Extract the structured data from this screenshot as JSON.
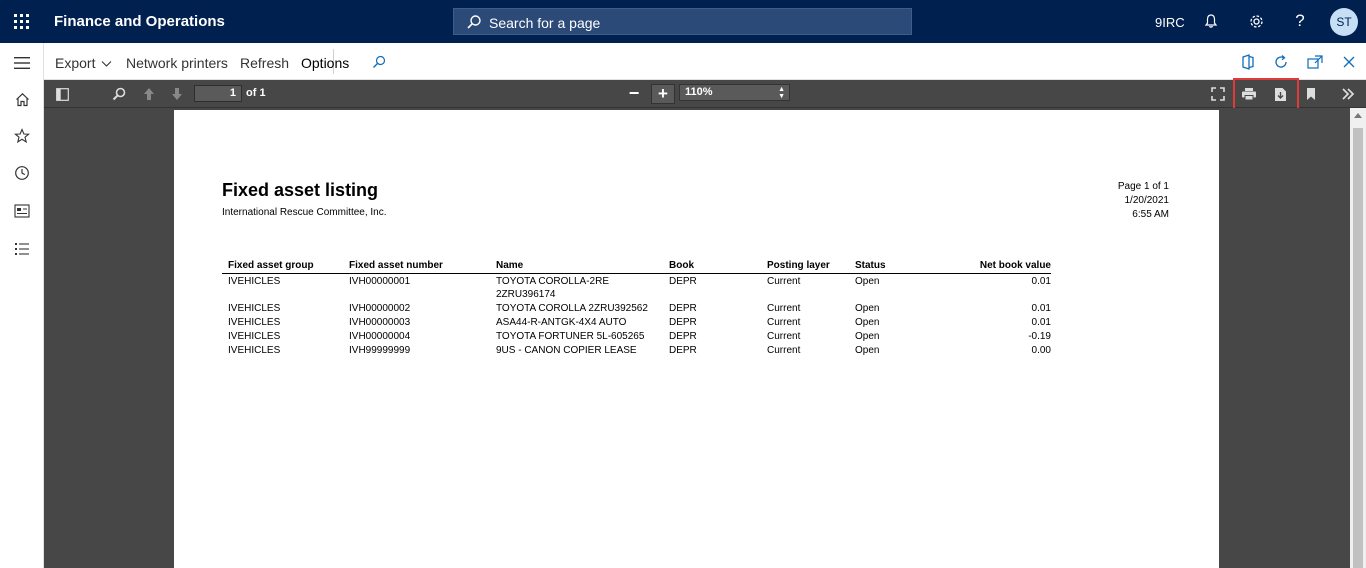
{
  "header": {
    "app_title": "Finance and Operations",
    "search_placeholder": "Search for a page",
    "company": "9IRC",
    "user_initials": "ST"
  },
  "action_pane": {
    "export_label": "Export",
    "network_printers_label": "Network printers",
    "refresh_label": "Refresh",
    "options_label": "Options"
  },
  "viewer": {
    "current_page": "1",
    "page_of": "of 1",
    "zoom": "110%"
  },
  "report": {
    "title": "Fixed asset listing",
    "company": "International Rescue Committee, Inc.",
    "page_info": "Page 1 of 1",
    "date": "1/20/2021",
    "time": "6:55 AM",
    "columns": [
      "Fixed asset group",
      "Fixed asset number",
      "Name",
      "Book",
      "Posting layer",
      "Status",
      "Net book value"
    ],
    "rows": [
      {
        "group": "IVEHICLES",
        "number": "IVH00000001",
        "name_line1": "TOYOTA COROLLA-2RE",
        "name_line2": "2ZRU396174",
        "book": "DEPR",
        "layer": "Current",
        "status": "Open",
        "value": "0.01"
      },
      {
        "group": "IVEHICLES",
        "number": "IVH00000002",
        "name_line1": "TOYOTA COROLLA 2ZRU392562",
        "name_line2": "",
        "book": "DEPR",
        "layer": "Current",
        "status": "Open",
        "value": "0.01"
      },
      {
        "group": "IVEHICLES",
        "number": "IVH00000003",
        "name_line1": "ASA44-R-ANTGK-4X4 AUTO",
        "name_line2": "",
        "book": "DEPR",
        "layer": "Current",
        "status": "Open",
        "value": "0.01"
      },
      {
        "group": "IVEHICLES",
        "number": "IVH00000004",
        "name_line1": "TOYOTA FORTUNER 5L-605265",
        "name_line2": "",
        "book": "DEPR",
        "layer": "Current",
        "status": "Open",
        "value": "-0.19"
      },
      {
        "group": "IVEHICLES",
        "number": "IVH99999999",
        "name_line1": "9US - CANON COPIER LEASE",
        "name_line2": "",
        "book": "DEPR",
        "layer": "Current",
        "status": "Open",
        "value": "0.00"
      }
    ]
  },
  "colors": {
    "header_bg": "#002050",
    "viewer_bg": "#474747",
    "highlight": "#e03b3b"
  }
}
